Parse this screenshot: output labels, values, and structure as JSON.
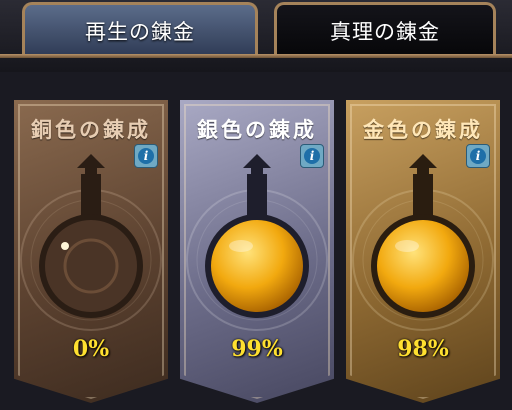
{
  "tabs": [
    {
      "label": "再生の錬金",
      "active": true
    },
    {
      "label": "真理の錬金",
      "active": false
    }
  ],
  "panels": [
    {
      "title": "銅色の錬成",
      "percent": "0%",
      "fill_level": 0,
      "theme": "copper",
      "info_icon": "info-icon"
    },
    {
      "title": "銀色の錬成",
      "percent": "99%",
      "fill_level": 0.99,
      "theme": "silver",
      "info_icon": "info-icon"
    },
    {
      "title": "金色の錬成",
      "percent": "98%",
      "fill_level": 0.98,
      "theme": "gold",
      "info_icon": "info-icon"
    }
  ],
  "colors": {
    "tab_border": "#a5835a",
    "percent_text": "#ffe030",
    "liquid": "#f2a90f"
  }
}
